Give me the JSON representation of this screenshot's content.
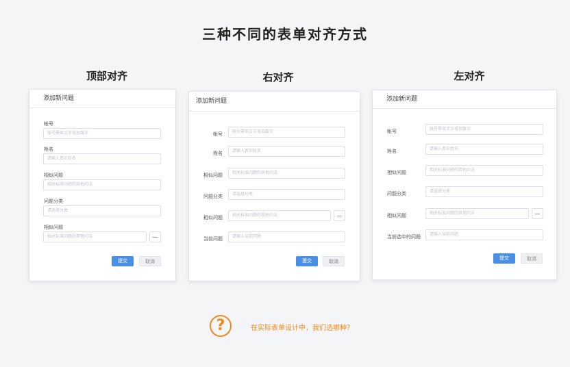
{
  "title": "三种不同的表单对齐方式",
  "columns": {
    "top": {
      "heading": "顶部对齐"
    },
    "right": {
      "heading": "右对齐"
    },
    "left": {
      "heading": "左对齐"
    }
  },
  "card_title": "添加新问题",
  "top_form": {
    "fields": [
      {
        "label": "帐号",
        "placeholder": "帐号需英文字母加数字"
      },
      {
        "label": "姓名",
        "placeholder": "请输入真实姓名"
      },
      {
        "label": "相似问题",
        "placeholder": "相关标准问题的其他问法"
      },
      {
        "label": "问题分类",
        "placeholder": "请选择分类"
      },
      {
        "label": "相似问题",
        "placeholder": "相关标准问题的其他问法"
      }
    ]
  },
  "right_form": {
    "fields": [
      {
        "label": "帐号",
        "placeholder": "帐号需英文字母加数字"
      },
      {
        "label": "姓名",
        "placeholder": "请输入真实姓名"
      },
      {
        "label": "相似问题",
        "placeholder": "相关标准问题的其他问法"
      },
      {
        "label": "问题分类",
        "placeholder": "请选择分类"
      },
      {
        "label": "相似问题",
        "placeholder": "相关标准问题的其他问法"
      },
      {
        "label": "当前问题",
        "placeholder": "请输入当前问题"
      }
    ]
  },
  "left_form": {
    "fields": [
      {
        "label": "帐号",
        "placeholder": "帐号需英文字母加数字"
      },
      {
        "label": "姓名",
        "placeholder": "请输入真实姓名"
      },
      {
        "label": "相似问题",
        "placeholder": "相关标准问题的其他问法"
      },
      {
        "label": "问题分类",
        "placeholder": "请选择分类"
      },
      {
        "label": "相似问题",
        "placeholder": "相关标准问题的其他问法"
      },
      {
        "label": "当前选中的问题",
        "placeholder": "请输入当前问题"
      }
    ]
  },
  "buttons": {
    "submit": "提交",
    "cancel": "取消"
  },
  "question": {
    "icon": "question-icon",
    "text": "在实际表单设计中，我们选哪种？"
  },
  "colors": {
    "accent": "#4a8ee6",
    "orange": "#f08a1c"
  }
}
